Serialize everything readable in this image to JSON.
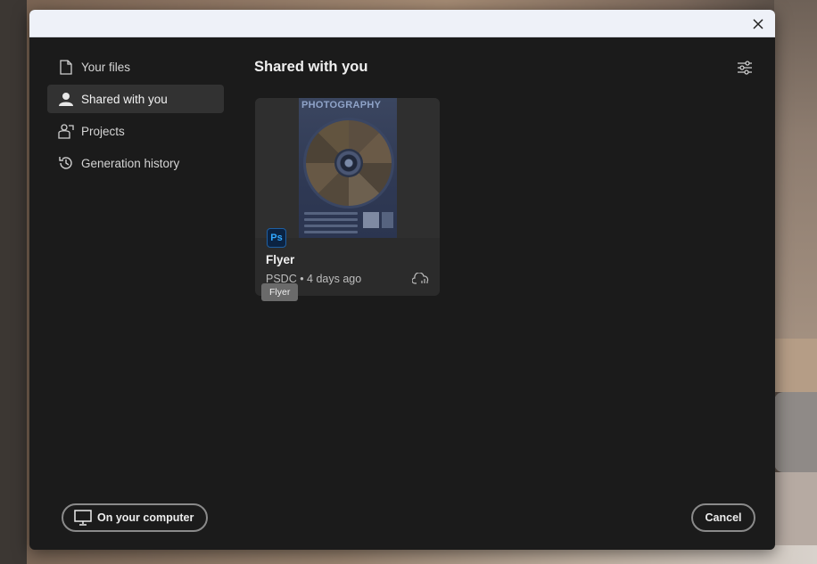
{
  "dialog": {
    "title": "Shared with you",
    "close_icon": "close-icon",
    "filter_icon": "filter-sliders-icon"
  },
  "sidebar": {
    "items": [
      {
        "label": "Your files",
        "icon": "file-icon",
        "active": false
      },
      {
        "label": "Shared with you",
        "icon": "user-icon",
        "active": true
      },
      {
        "label": "Projects",
        "icon": "projects-icon",
        "active": false
      },
      {
        "label": "Generation history",
        "icon": "history-icon",
        "active": false
      }
    ]
  },
  "files": [
    {
      "name": "Flyer",
      "app_badge": "Ps",
      "meta": "PSDC • 4 days ago",
      "thumbnail_title": "PHOTOGRAPHY",
      "cloud_icon": "cloud-sync-icon",
      "tooltip": "Flyer"
    }
  ],
  "footer": {
    "computer_label": "On your computer",
    "cancel_label": "Cancel"
  },
  "colors": {
    "dialog_bg": "#1b1b1b",
    "card_bg": "#2b2b2b",
    "active_nav": "#323232",
    "ps_blue": "#31a8ff"
  }
}
